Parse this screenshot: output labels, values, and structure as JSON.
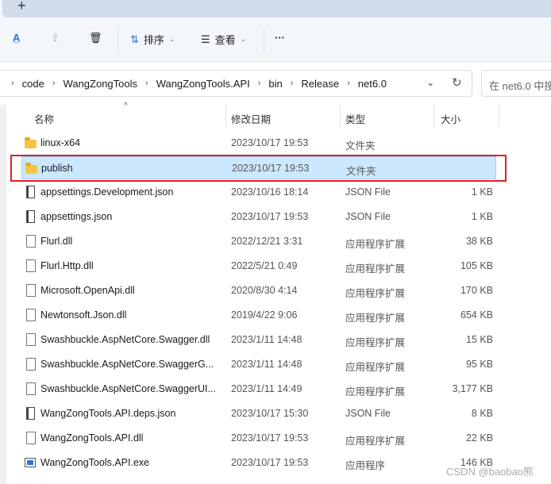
{
  "tabbar": {
    "new_tab": "+"
  },
  "toolbar": {
    "sort": "排序",
    "view": "查看",
    "more": "···"
  },
  "breadcrumb": [
    "code",
    "WangZongTools",
    "WangZongTools.API",
    "bin",
    "Release",
    "net6.0"
  ],
  "search": {
    "placeholder": "在 net6.0 中搜"
  },
  "columns": {
    "name": "名称",
    "date": "修改日期",
    "type": "类型",
    "size": "大小"
  },
  "files": [
    {
      "name": "linux-x64",
      "date": "2023/10/17 19:53",
      "type": "文件夹",
      "size": "",
      "icon": "folder"
    },
    {
      "name": "publish",
      "date": "2023/10/17 19:53",
      "type": "文件夹",
      "size": "",
      "icon": "folder",
      "selected": true
    },
    {
      "name": "appsettings.Development.json",
      "date": "2023/10/16 18:14",
      "type": "JSON File",
      "size": "1 KB",
      "icon": "json"
    },
    {
      "name": "appsettings.json",
      "date": "2023/10/17 19:53",
      "type": "JSON File",
      "size": "1 KB",
      "icon": "json"
    },
    {
      "name": "Flurl.dll",
      "date": "2022/12/21 3:31",
      "type": "应用程序扩展",
      "size": "38 KB",
      "icon": "file"
    },
    {
      "name": "Flurl.Http.dll",
      "date": "2022/5/21 0:49",
      "type": "应用程序扩展",
      "size": "105 KB",
      "icon": "file"
    },
    {
      "name": "Microsoft.OpenApi.dll",
      "date": "2020/8/30 4:14",
      "type": "应用程序扩展",
      "size": "170 KB",
      "icon": "file"
    },
    {
      "name": "Newtonsoft.Json.dll",
      "date": "2019/4/22 9:06",
      "type": "应用程序扩展",
      "size": "654 KB",
      "icon": "file"
    },
    {
      "name": "Swashbuckle.AspNetCore.Swagger.dll",
      "date": "2023/1/11 14:48",
      "type": "应用程序扩展",
      "size": "15 KB",
      "icon": "file"
    },
    {
      "name": "Swashbuckle.AspNetCore.SwaggerG...",
      "date": "2023/1/11 14:48",
      "type": "应用程序扩展",
      "size": "95 KB",
      "icon": "file"
    },
    {
      "name": "Swashbuckle.AspNetCore.SwaggerUI...",
      "date": "2023/1/11 14:49",
      "type": "应用程序扩展",
      "size": "3,177 KB",
      "icon": "file"
    },
    {
      "name": "WangZongTools.API.deps.json",
      "date": "2023/10/17 15:30",
      "type": "JSON File",
      "size": "8 KB",
      "icon": "json"
    },
    {
      "name": "WangZongTools.API.dll",
      "date": "2023/10/17 19:53",
      "type": "应用程序扩展",
      "size": "22 KB",
      "icon": "file"
    },
    {
      "name": "WangZongTools.API.exe",
      "date": "2023/10/17 19:53",
      "type": "应用程序",
      "size": "146 KB",
      "icon": "exe"
    }
  ],
  "watermark": "CSDN @baobao熊"
}
